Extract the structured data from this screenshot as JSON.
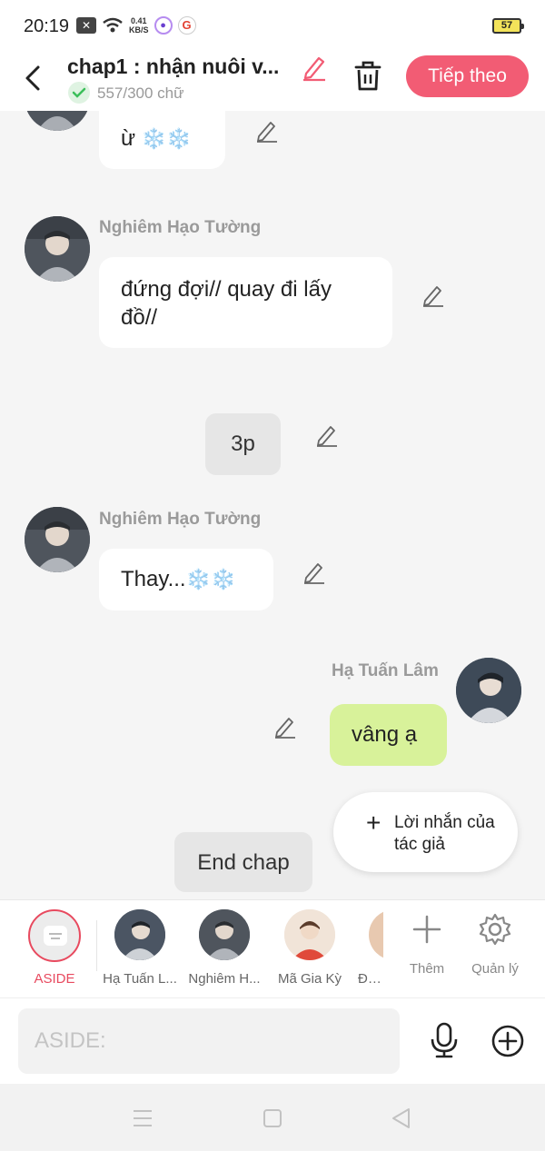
{
  "status": {
    "time": "20:19",
    "speed_top": "0.41",
    "speed_unit": "KB/S",
    "g_label": "G",
    "battery": "57"
  },
  "header": {
    "title": "chap1 : nhận nuôi v...",
    "word_count": "557/300 chữ",
    "next_label": "Tiếp theo"
  },
  "messages": [
    {
      "kind": "left",
      "text": "ừ",
      "snow": "❄️❄️"
    },
    {
      "kind": "left",
      "sender": "Nghiêm Hạo Tường",
      "text": "đứng đợi// quay đi lấy đồ//"
    },
    {
      "kind": "center",
      "text": "3p"
    },
    {
      "kind": "left",
      "sender": "Nghiêm Hạo Tường",
      "text": "Thay...",
      "snow": "❄️❄️"
    },
    {
      "kind": "right",
      "sender": "Hạ Tuấn Lâm",
      "text": "vâng ạ"
    },
    {
      "kind": "center",
      "text": "End chap"
    }
  ],
  "author_note": {
    "plus": "+",
    "label": "Lời nhắn của tác giả"
  },
  "characters": [
    {
      "name": "ASIDE",
      "active": true
    },
    {
      "name": "Hạ Tuấn L..."
    },
    {
      "name": "Nghiêm H..."
    },
    {
      "name": "Mã Gia Kỳ"
    },
    {
      "name": "Đinh"
    }
  ],
  "tools": {
    "add_label": "Thêm",
    "manage_label": "Quản lý"
  },
  "input": {
    "placeholder": "ASIDE:"
  },
  "colors": {
    "accent": "#f25c74",
    "active_char": "#e84a5f",
    "self_bubble": "#d8f29a"
  }
}
